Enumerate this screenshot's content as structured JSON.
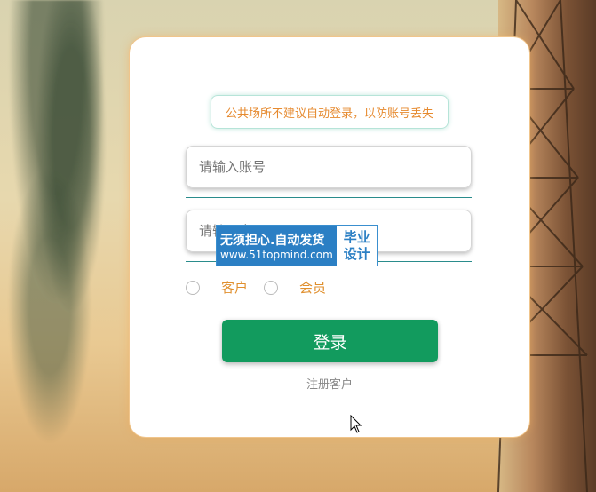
{
  "notice": "公共场所不建议自动登录，以防账号丢失",
  "account": {
    "placeholder": "请输入账号"
  },
  "password": {
    "placeholder": "请输入密码"
  },
  "roles": [
    "客户",
    "会员"
  ],
  "login_label": "登录",
  "register_label": "注册客户",
  "watermark": {
    "line1": "无须担心.自动发货",
    "line2": "www.51topmind.com",
    "right1": "毕业",
    "right2": "设计"
  },
  "colors": {
    "accent": "#129b5e",
    "notice_text": "#e68a2f",
    "role_text": "#e0902f"
  }
}
